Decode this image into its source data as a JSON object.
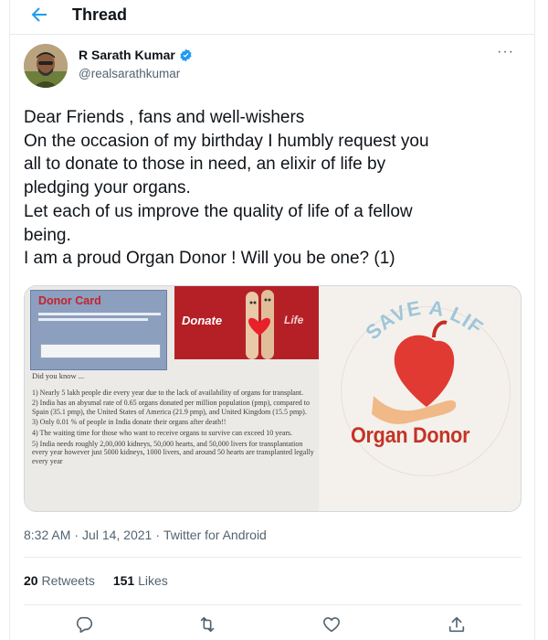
{
  "header": {
    "title": "Thread",
    "back_icon": "arrow-left-icon"
  },
  "author": {
    "name": "R Sarath Kumar",
    "handle": "@realsarathkumar",
    "verified": true
  },
  "tweet": {
    "lines": [
      "Dear Friends , fans and well-wishers",
      "On the occasion of my birthday I humbly request you",
      "all  to donate to those in need, an elixir of life by",
      "pledging your organs.",
      "Let each of us improve the quality of life of a fellow",
      "being.",
      "I am  a proud Organ Donor ! Will you be one? (1)"
    ]
  },
  "media": {
    "donor_card_title": "Donor Card",
    "donate_word": "Donate",
    "life_word": "Life",
    "save_a_life": "SAVE A LIFE",
    "organ_donor": "Organ Donor",
    "did_you_know": "Did you know ...",
    "facts": [
      "1) Nearly 5 lakh people die every year due to the lack of availability of organs for transplant.",
      "2) India has an abysmal rate of 0.65 organs donated per million population (pmp), compared to Spain (35.1 pmp), the United States of America (21.9 pmp), and United Kingdom (15.5 pmp).",
      "3) Only 0.01 % of people in India donate their organs after death!!",
      "4)  The waiting time for those who want to receive organs to survive can exceed 10 years.",
      "5) India needs roughly 2,00,000 kidneys, 50,000 hearts, and 50,000 livers for transplantation every year however just 5000 kidneys, 1000 livers, and around 50 hearts are transplanted legally every year"
    ]
  },
  "meta": {
    "time": "8:32 AM",
    "sep1": "·",
    "date": "Jul 14, 2021",
    "sep2": "·",
    "source": "Twitter for Android"
  },
  "stats": {
    "retweets_count": "20",
    "retweets_label": "Retweets",
    "likes_count": "151",
    "likes_label": "Likes"
  },
  "colors": {
    "accent": "#1d9bf0",
    "muted": "#536471",
    "text": "#0f1419",
    "border": "#e6ecf0"
  }
}
